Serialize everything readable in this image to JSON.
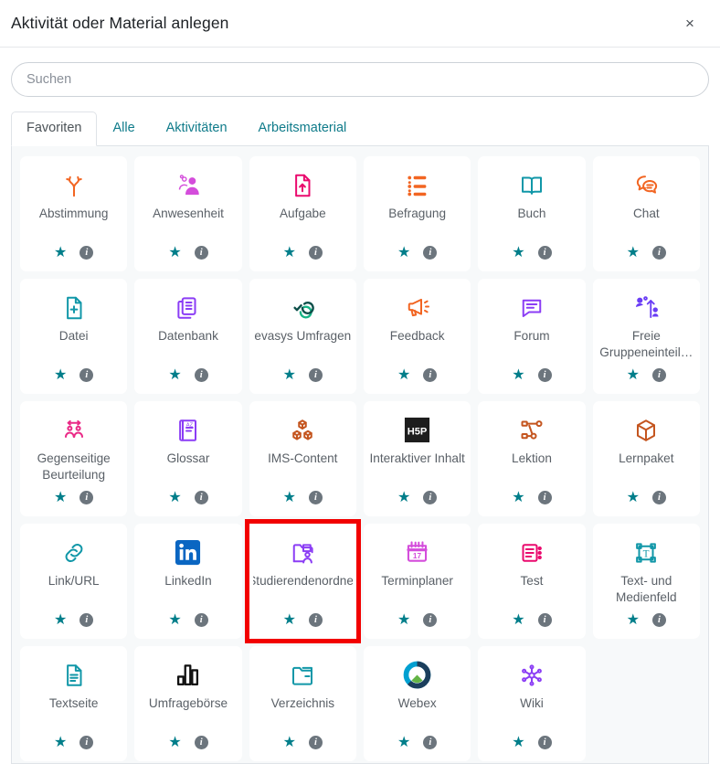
{
  "header": {
    "title": "Aktivität oder Material anlegen",
    "close_label": "×",
    "close_name": "close-icon"
  },
  "search": {
    "placeholder": "Suchen",
    "value": ""
  },
  "tabs": [
    {
      "label": "Favoriten",
      "active": true
    },
    {
      "label": "Alle",
      "active": false
    },
    {
      "label": "Aktivitäten",
      "active": false
    },
    {
      "label": "Arbeitsmaterial",
      "active": false
    }
  ],
  "actions": {
    "star_glyph": "★",
    "info_glyph": "i",
    "star_name": "favorite-star-icon",
    "info_name": "info-icon"
  },
  "colors": {
    "accent_teal": "#007e8a",
    "tab_link": "#0f7b8a",
    "highlight_red": "#f20000",
    "card_bg": "#ffffff",
    "grid_bg": "#f7f9fa",
    "label_text": "#5a6067"
  },
  "items": [
    {
      "label": "Abstimmung",
      "icon": "choice-arrows-icon",
      "color": "#f26522",
      "highlighted": false
    },
    {
      "label": "Anwesenheit",
      "icon": "attendance-people-icon",
      "color": "#d44ddb",
      "highlighted": false
    },
    {
      "label": "Aufgabe",
      "icon": "assignment-upload-icon",
      "color": "#ea0a6e",
      "highlighted": false
    },
    {
      "label": "Befragung",
      "icon": "survey-list-icon",
      "color": "#f26522",
      "highlighted": false
    },
    {
      "label": "Buch",
      "icon": "book-open-icon",
      "color": "#1197a8",
      "highlighted": false
    },
    {
      "label": "Chat",
      "icon": "chat-bubbles-icon",
      "color": "#f26522",
      "highlighted": false
    },
    {
      "label": "Datei",
      "icon": "file-plus-icon",
      "color": "#1197a8",
      "highlighted": false
    },
    {
      "label": "Datenbank",
      "icon": "database-stack-icon",
      "color": "#8b3df5",
      "highlighted": false
    },
    {
      "label": "evasys Umfragen",
      "icon": "evasys-check-loop-icon",
      "color": "#00a08a",
      "highlighted": false
    },
    {
      "label": "Feedback",
      "icon": "megaphone-icon",
      "color": "#f26522",
      "highlighted": false
    },
    {
      "label": "Forum",
      "icon": "forum-bubble-icon",
      "color": "#8b3df5",
      "highlighted": false
    },
    {
      "label": "Freie Gruppeneinteil…",
      "icon": "group-choice-icon",
      "color": "#6a3df5",
      "highlighted": false
    },
    {
      "label": "Gegenseitige Beurteilung",
      "icon": "peer-review-icon",
      "color": "#ea2a87",
      "highlighted": false
    },
    {
      "label": "Glossar",
      "icon": "glossary-book-icon",
      "color": "#8b3df5",
      "highlighted": false
    },
    {
      "label": "IMS-Content",
      "icon": "ims-blocks-icon",
      "color": "#c4551f",
      "highlighted": false
    },
    {
      "label": "Interaktiver Inhalt",
      "icon": "h5p-logo-icon",
      "color": "#1d1d1d",
      "highlighted": false
    },
    {
      "label": "Lektion",
      "icon": "lesson-nodes-icon",
      "color": "#c4551f",
      "highlighted": false
    },
    {
      "label": "Lernpaket",
      "icon": "scorm-package-icon",
      "color": "#c4551f",
      "highlighted": false
    },
    {
      "label": "Link/URL",
      "icon": "link-chain-icon",
      "color": "#1197a8",
      "highlighted": false
    },
    {
      "label": "LinkedIn",
      "icon": "linkedin-logo-icon",
      "color": "#0a66c2",
      "highlighted": false
    },
    {
      "label": "Studierendenordner",
      "icon": "student-folder-icon",
      "color": "#8b3df5",
      "highlighted": true
    },
    {
      "label": "Terminplaner",
      "icon": "scheduler-calendar-icon",
      "color": "#d44ddb",
      "highlighted": false
    },
    {
      "label": "Test",
      "icon": "quiz-checklist-icon",
      "color": "#ea0a6e",
      "highlighted": false
    },
    {
      "label": "Text- und Medienfeld",
      "icon": "text-media-icon",
      "color": "#1197a8",
      "highlighted": false
    },
    {
      "label": "Textseite",
      "icon": "page-text-icon",
      "color": "#1197a8",
      "highlighted": false
    },
    {
      "label": "Umfragebörse",
      "icon": "survey-bars-icon",
      "color": "#111111",
      "highlighted": false
    },
    {
      "label": "Verzeichnis",
      "icon": "folder-icon",
      "color": "#1197a8",
      "highlighted": false
    },
    {
      "label": "Webex",
      "icon": "webex-logo-icon",
      "color": "#00a0d1",
      "highlighted": false
    },
    {
      "label": "Wiki",
      "icon": "wiki-network-icon",
      "color": "#8b3df5",
      "highlighted": false
    }
  ]
}
